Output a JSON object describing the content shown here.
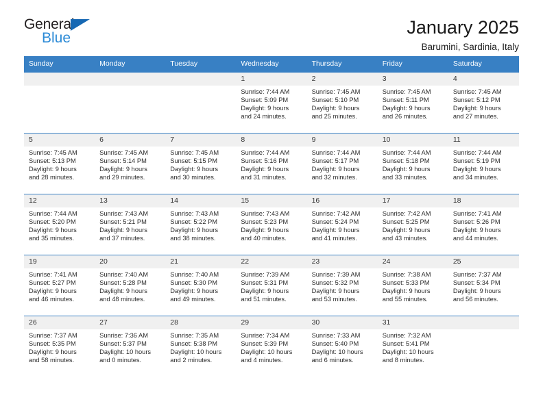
{
  "logo": {
    "word_one": "General",
    "word_two": "Blue",
    "triangle": "triangle-mark"
  },
  "header": {
    "title": "January 2025",
    "subtitle": "Barumini, Sardinia, Italy"
  },
  "colors": {
    "header_blue": "#3880c4",
    "logo_blue": "#2b8ad6",
    "logo_dark": "#231f20",
    "day_band": "#f0f0f0"
  },
  "calendar": {
    "weekdays": [
      "Sunday",
      "Monday",
      "Tuesday",
      "Wednesday",
      "Thursday",
      "Friday",
      "Saturday"
    ],
    "weeks": [
      [
        {
          "day": "",
          "lines": []
        },
        {
          "day": "",
          "lines": []
        },
        {
          "day": "",
          "lines": []
        },
        {
          "day": "1",
          "lines": [
            "Sunrise: 7:44 AM",
            "Sunset: 5:09 PM",
            "Daylight: 9 hours",
            "and 24 minutes."
          ]
        },
        {
          "day": "2",
          "lines": [
            "Sunrise: 7:45 AM",
            "Sunset: 5:10 PM",
            "Daylight: 9 hours",
            "and 25 minutes."
          ]
        },
        {
          "day": "3",
          "lines": [
            "Sunrise: 7:45 AM",
            "Sunset: 5:11 PM",
            "Daylight: 9 hours",
            "and 26 minutes."
          ]
        },
        {
          "day": "4",
          "lines": [
            "Sunrise: 7:45 AM",
            "Sunset: 5:12 PM",
            "Daylight: 9 hours",
            "and 27 minutes."
          ]
        }
      ],
      [
        {
          "day": "5",
          "lines": [
            "Sunrise: 7:45 AM",
            "Sunset: 5:13 PM",
            "Daylight: 9 hours",
            "and 28 minutes."
          ]
        },
        {
          "day": "6",
          "lines": [
            "Sunrise: 7:45 AM",
            "Sunset: 5:14 PM",
            "Daylight: 9 hours",
            "and 29 minutes."
          ]
        },
        {
          "day": "7",
          "lines": [
            "Sunrise: 7:45 AM",
            "Sunset: 5:15 PM",
            "Daylight: 9 hours",
            "and 30 minutes."
          ]
        },
        {
          "day": "8",
          "lines": [
            "Sunrise: 7:44 AM",
            "Sunset: 5:16 PM",
            "Daylight: 9 hours",
            "and 31 minutes."
          ]
        },
        {
          "day": "9",
          "lines": [
            "Sunrise: 7:44 AM",
            "Sunset: 5:17 PM",
            "Daylight: 9 hours",
            "and 32 minutes."
          ]
        },
        {
          "day": "10",
          "lines": [
            "Sunrise: 7:44 AM",
            "Sunset: 5:18 PM",
            "Daylight: 9 hours",
            "and 33 minutes."
          ]
        },
        {
          "day": "11",
          "lines": [
            "Sunrise: 7:44 AM",
            "Sunset: 5:19 PM",
            "Daylight: 9 hours",
            "and 34 minutes."
          ]
        }
      ],
      [
        {
          "day": "12",
          "lines": [
            "Sunrise: 7:44 AM",
            "Sunset: 5:20 PM",
            "Daylight: 9 hours",
            "and 35 minutes."
          ]
        },
        {
          "day": "13",
          "lines": [
            "Sunrise: 7:43 AM",
            "Sunset: 5:21 PM",
            "Daylight: 9 hours",
            "and 37 minutes."
          ]
        },
        {
          "day": "14",
          "lines": [
            "Sunrise: 7:43 AM",
            "Sunset: 5:22 PM",
            "Daylight: 9 hours",
            "and 38 minutes."
          ]
        },
        {
          "day": "15",
          "lines": [
            "Sunrise: 7:43 AM",
            "Sunset: 5:23 PM",
            "Daylight: 9 hours",
            "and 40 minutes."
          ]
        },
        {
          "day": "16",
          "lines": [
            "Sunrise: 7:42 AM",
            "Sunset: 5:24 PM",
            "Daylight: 9 hours",
            "and 41 minutes."
          ]
        },
        {
          "day": "17",
          "lines": [
            "Sunrise: 7:42 AM",
            "Sunset: 5:25 PM",
            "Daylight: 9 hours",
            "and 43 minutes."
          ]
        },
        {
          "day": "18",
          "lines": [
            "Sunrise: 7:41 AM",
            "Sunset: 5:26 PM",
            "Daylight: 9 hours",
            "and 44 minutes."
          ]
        }
      ],
      [
        {
          "day": "19",
          "lines": [
            "Sunrise: 7:41 AM",
            "Sunset: 5:27 PM",
            "Daylight: 9 hours",
            "and 46 minutes."
          ]
        },
        {
          "day": "20",
          "lines": [
            "Sunrise: 7:40 AM",
            "Sunset: 5:28 PM",
            "Daylight: 9 hours",
            "and 48 minutes."
          ]
        },
        {
          "day": "21",
          "lines": [
            "Sunrise: 7:40 AM",
            "Sunset: 5:30 PM",
            "Daylight: 9 hours",
            "and 49 minutes."
          ]
        },
        {
          "day": "22",
          "lines": [
            "Sunrise: 7:39 AM",
            "Sunset: 5:31 PM",
            "Daylight: 9 hours",
            "and 51 minutes."
          ]
        },
        {
          "day": "23",
          "lines": [
            "Sunrise: 7:39 AM",
            "Sunset: 5:32 PM",
            "Daylight: 9 hours",
            "and 53 minutes."
          ]
        },
        {
          "day": "24",
          "lines": [
            "Sunrise: 7:38 AM",
            "Sunset: 5:33 PM",
            "Daylight: 9 hours",
            "and 55 minutes."
          ]
        },
        {
          "day": "25",
          "lines": [
            "Sunrise: 7:37 AM",
            "Sunset: 5:34 PM",
            "Daylight: 9 hours",
            "and 56 minutes."
          ]
        }
      ],
      [
        {
          "day": "26",
          "lines": [
            "Sunrise: 7:37 AM",
            "Sunset: 5:35 PM",
            "Daylight: 9 hours",
            "and 58 minutes."
          ]
        },
        {
          "day": "27",
          "lines": [
            "Sunrise: 7:36 AM",
            "Sunset: 5:37 PM",
            "Daylight: 10 hours",
            "and 0 minutes."
          ]
        },
        {
          "day": "28",
          "lines": [
            "Sunrise: 7:35 AM",
            "Sunset: 5:38 PM",
            "Daylight: 10 hours",
            "and 2 minutes."
          ]
        },
        {
          "day": "29",
          "lines": [
            "Sunrise: 7:34 AM",
            "Sunset: 5:39 PM",
            "Daylight: 10 hours",
            "and 4 minutes."
          ]
        },
        {
          "day": "30",
          "lines": [
            "Sunrise: 7:33 AM",
            "Sunset: 5:40 PM",
            "Daylight: 10 hours",
            "and 6 minutes."
          ]
        },
        {
          "day": "31",
          "lines": [
            "Sunrise: 7:32 AM",
            "Sunset: 5:41 PM",
            "Daylight: 10 hours",
            "and 8 minutes."
          ]
        },
        {
          "day": "",
          "lines": []
        }
      ]
    ]
  }
}
